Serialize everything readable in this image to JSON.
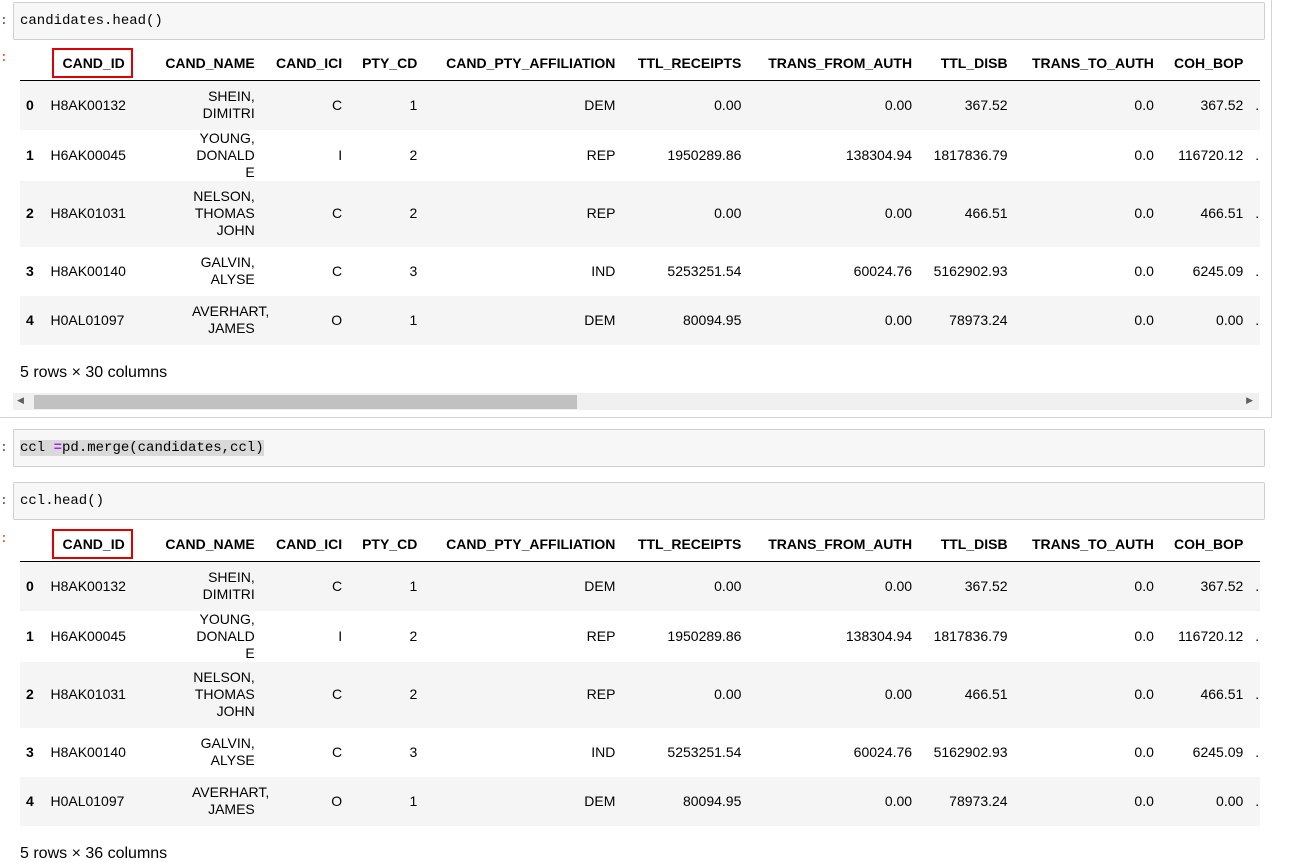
{
  "cells": [
    {
      "prompt": ":",
      "code": "candidates.head()",
      "out_prompt": ":"
    },
    {
      "prompt": ":",
      "code_var": "ccl",
      "code_op": "=",
      "code_rest": "pd.merge(candidates,ccl)"
    },
    {
      "prompt": ":",
      "code": "ccl.head()",
      "out_prompt": ":"
    }
  ],
  "columns": [
    "",
    "CAND_ID",
    "CAND_NAME",
    "CAND_ICI",
    "PTY_CD",
    "CAND_PTY_AFFILIATION",
    "TTL_RECEIPTS",
    "TRANS_FROM_AUTH",
    "TTL_DISB",
    "TRANS_TO_AUTH",
    "COH_BOP",
    "..."
  ],
  "rows": [
    [
      "0",
      "H8AK00132",
      "SHEIN, DIMITRI",
      "C",
      "1",
      "DEM",
      "0.00",
      "0.00",
      "367.52",
      "0.0",
      "367.52",
      "..."
    ],
    [
      "1",
      "H6AK00045",
      "YOUNG, DONALD E",
      "I",
      "2",
      "REP",
      "1950289.86",
      "138304.94",
      "1817836.79",
      "0.0",
      "116720.12",
      "..."
    ],
    [
      "2",
      "H8AK01031",
      "NELSON, THOMAS JOHN",
      "C",
      "2",
      "REP",
      "0.00",
      "0.00",
      "466.51",
      "0.0",
      "466.51",
      "..."
    ],
    [
      "3",
      "H8AK00140",
      "GALVIN, ALYSE",
      "C",
      "3",
      "IND",
      "5253251.54",
      "60024.76",
      "5162902.93",
      "0.0",
      "6245.09",
      "..."
    ],
    [
      "4",
      "H0AL01097",
      "AVERHART, JAMES",
      "O",
      "1",
      "DEM",
      "80094.95",
      "0.00",
      "78973.24",
      "0.0",
      "0.00",
      "..."
    ]
  ],
  "captions": [
    "5 rows × 30 columns",
    "5 rows × 36 columns"
  ],
  "scroll_arrows": {
    "left": "◀",
    "right": "▶"
  },
  "highlight_color": "#e00000"
}
